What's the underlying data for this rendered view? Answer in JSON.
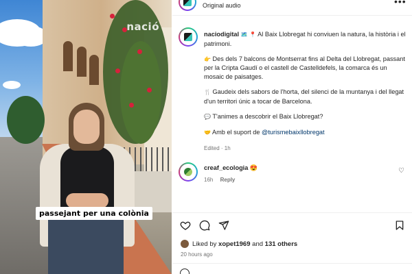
{
  "video": {
    "watermark": "nació",
    "subtitle": "passejant per una colònia"
  },
  "header": {
    "audio_label": "Original audio",
    "more_glyph": "•••"
  },
  "post": {
    "username": "naciodigital",
    "intro_emojis": "🗺️ 📍",
    "intro_text": "Al Baix Llobregat hi conviuen la natura, la història i el patrimoni.",
    "p2_emoji": "👉",
    "p2_text": "Des dels 7 balcons de Montserrat fins al Delta del Llobregat, passant per la Cripta Gaudí o el castell de Castelldefels, la comarca és un mosaic de paisatges.",
    "p3_emoji": "🍴",
    "p3_text": "Gaudeix dels sabors de l'horta, del silenci de la muntanya i del llegat d'un territori únic a tocar de Barcelona.",
    "p4_emoji": "💬",
    "p4_text": "T'animes a descobrir el Baix Llobregat?",
    "p5_emoji": "🤝",
    "p5_text": "Amb el suport de",
    "p5_mention": "@turismebaixllobregat",
    "meta": "Edited · 1h"
  },
  "comment": {
    "username": "creaf_ecologia",
    "text": "😍",
    "time": "16h",
    "reply_label": "Reply",
    "like_glyph": "♡"
  },
  "actions": {
    "like": "like-icon",
    "comment": "comment-icon",
    "share": "share-icon",
    "save": "save-icon"
  },
  "likes": {
    "prefix": "Liked by",
    "user": "xopet1969",
    "joiner": "and",
    "others": "131 others"
  },
  "timestamp": "20 hours ago"
}
